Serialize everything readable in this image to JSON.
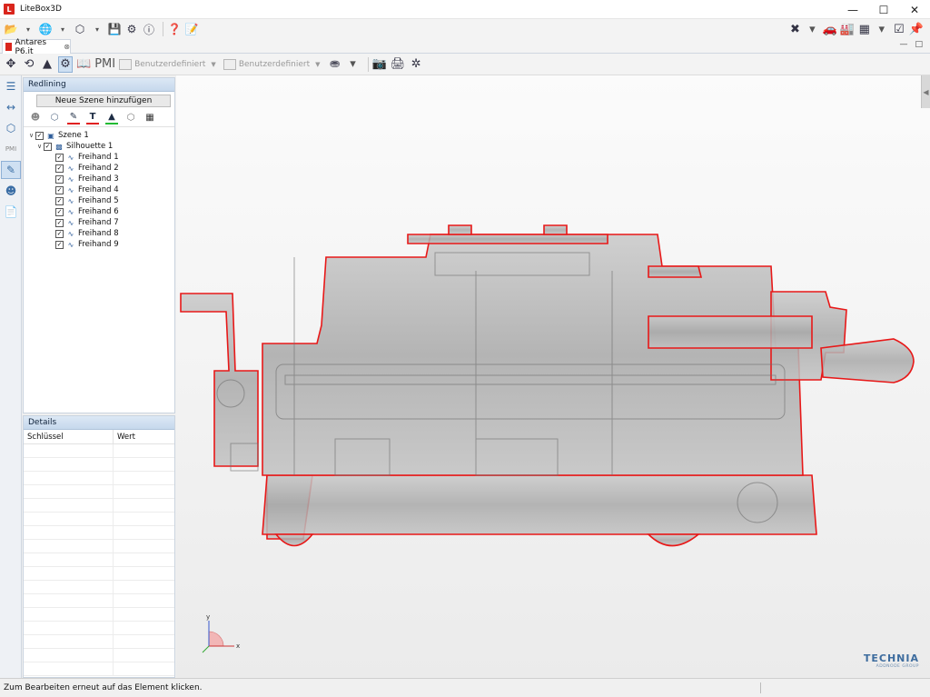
{
  "window": {
    "title": "LiteBox3D",
    "controls": [
      "minimize",
      "maximize",
      "close"
    ]
  },
  "document_tab": {
    "label": "Antares P6.jt"
  },
  "toolbar2": {
    "custom_label_1": "Benutzerdefiniert",
    "custom_label_2": "Benutzerdefiniert",
    "pmi_label": "PMI"
  },
  "side_panel": {
    "pmi_label": "PMI"
  },
  "redlining": {
    "header": "Redlining",
    "add_scene_button": "Neue Szene hinzufügen",
    "tool_colors": {
      "marker": "#e02020",
      "text": "#e02020",
      "fill": "#22bb33"
    },
    "tree": {
      "scene": "Szene 1",
      "silhouette": "Silhouette 1",
      "items": [
        "Freihand 1",
        "Freihand 2",
        "Freihand 3",
        "Freihand 4",
        "Freihand 5",
        "Freihand 6",
        "Freihand 7",
        "Freihand 8",
        "Freihand 9"
      ]
    }
  },
  "details": {
    "header": "Details",
    "col_key": "Schlüssel",
    "col_value": "Wert"
  },
  "viewport": {
    "axis_y": "y",
    "axis_x": "x",
    "brand_name": "TECHNIA",
    "brand_sub": "ADDNODE GROUP",
    "outline_color": "#e81818"
  },
  "status": {
    "message": "Zum Bearbeiten erneut auf das Element klicken."
  }
}
